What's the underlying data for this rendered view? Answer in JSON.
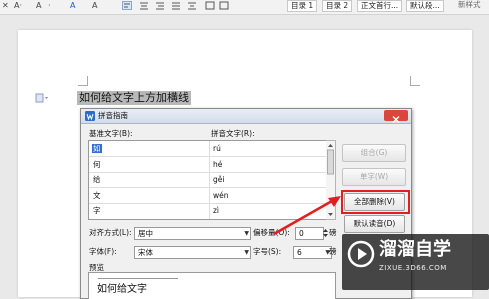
{
  "toolbar": {
    "tools": [
      "✕",
      "A·",
      "A",
      "·",
      "A",
      "A"
    ],
    "styles": [
      "目录 1",
      "目录 2",
      "正文首行...",
      "默认段...",
      "新样式"
    ]
  },
  "document": {
    "text": "如何给文字上方加横线"
  },
  "dialog": {
    "title": "拼音指南",
    "base_text_label": "基准文字(B):",
    "pinyin_label": "拼音文字(R):",
    "rows": [
      {
        "base": "如",
        "pinyin": "rú"
      },
      {
        "base": "何",
        "pinyin": "hé"
      },
      {
        "base": "给",
        "pinyin": "gěi"
      },
      {
        "base": "文",
        "pinyin": "wén"
      },
      {
        "base": "字",
        "pinyin": "zì"
      }
    ],
    "buttons": {
      "combine": "组合(G)",
      "single": "单字(W)",
      "clear_all": "全部删除(V)",
      "default_reading": "默认读音(D)"
    },
    "align_label": "对齐方式(L):",
    "align_value": "居中",
    "offset_label": "偏移量(O):",
    "offset_value": "0",
    "offset_unit": "磅",
    "font_label": "字体(F):",
    "font_value": "宋体",
    "size_label": "字号(S):",
    "size_value": "6",
    "size_unit": "磅",
    "preview_label": "预览",
    "preview_text": "如何给文字"
  },
  "watermark": {
    "title": "溜溜自学",
    "url": "ZIXUE.3D66.COM"
  },
  "colors": {
    "highlight_box": "#e02020",
    "arrow": "#e02020",
    "titlebar_icon": "#2b6cc4"
  }
}
